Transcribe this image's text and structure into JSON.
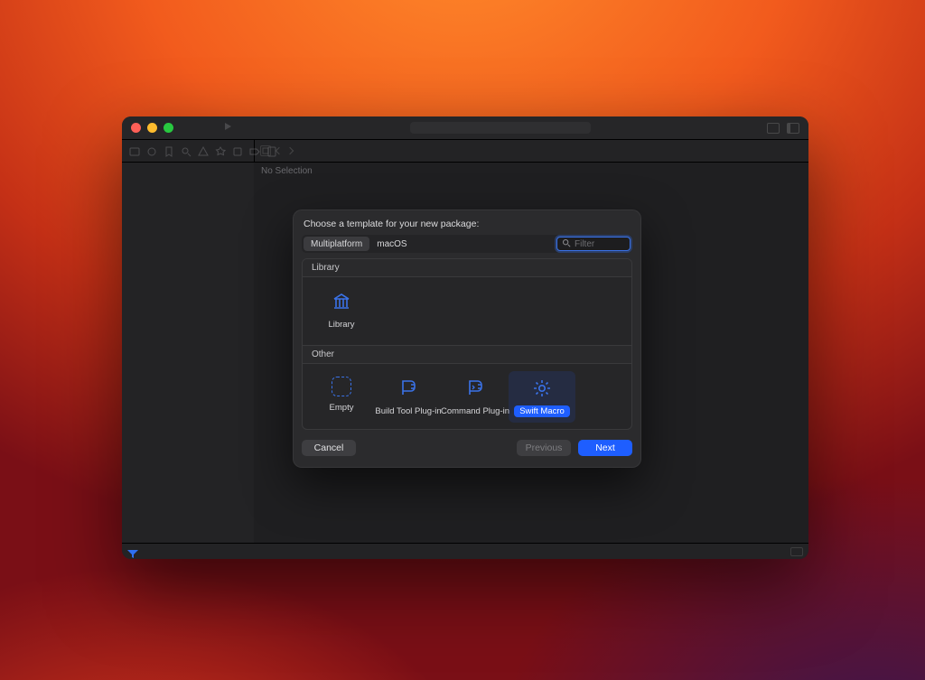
{
  "editor": {
    "no_selection": "No Selection"
  },
  "sheet": {
    "title": "Choose a template for your new package:",
    "tabs": [
      {
        "label": "Multiplatform",
        "active": true
      },
      {
        "label": "macOS",
        "active": false
      }
    ],
    "filter_placeholder": "Filter",
    "groups": [
      {
        "name": "Library",
        "items": [
          {
            "id": "library",
            "label": "Library",
            "icon": "library",
            "selected": false
          }
        ]
      },
      {
        "name": "Other",
        "items": [
          {
            "id": "empty",
            "label": "Empty",
            "icon": "empty",
            "selected": false
          },
          {
            "id": "build-tool-plugin",
            "label": "Build Tool Plug-in",
            "icon": "plug",
            "selected": false
          },
          {
            "id": "command-plugin",
            "label": "Command Plug-in",
            "icon": "plug-cmd",
            "selected": false
          },
          {
            "id": "swift-macro",
            "label": "Swift Macro",
            "icon": "gear",
            "selected": true
          }
        ]
      }
    ],
    "buttons": {
      "cancel": "Cancel",
      "previous": "Previous",
      "next": "Next"
    }
  }
}
